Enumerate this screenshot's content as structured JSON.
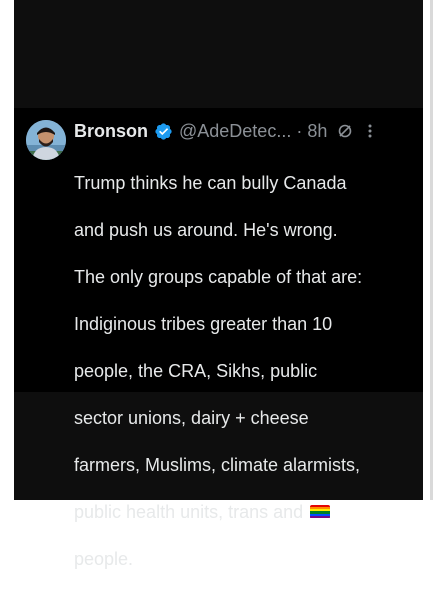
{
  "tweet": {
    "author": {
      "name": "Bronson",
      "handle": "@AdeDetec...",
      "time": "8h",
      "separator": "·",
      "verified_icon": "verified-badge-icon"
    },
    "text_lines": [
      "Trump thinks he can bully Canada",
      "and push us around. He's wrong.",
      "The only groups capable of that are:",
      "Indiginous tribes greater than 10",
      "people, the CRA, Sikhs, public",
      "sector unions, dairy + cheese",
      "farmers, Muslims, climate alarmists,",
      "public health units, trans and",
      "people."
    ],
    "emoji": "rainbow-flag-emoji",
    "colors": {
      "background": "#000000",
      "text": "#e7e9ea",
      "muted": "#8b9096",
      "verified": "#1d9bf0"
    }
  }
}
